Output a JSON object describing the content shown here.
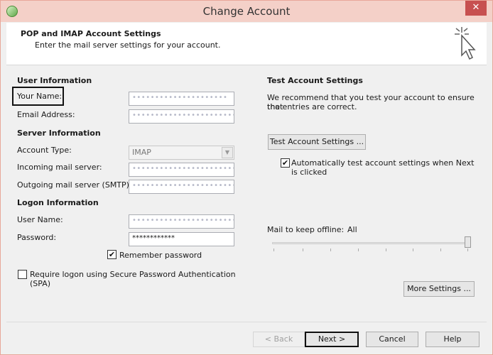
{
  "window": {
    "title": "Change Account"
  },
  "header": {
    "title": "POP and IMAP Account Settings",
    "subtitle": "Enter the mail server settings for your account."
  },
  "user_info": {
    "section": "User Information",
    "name_label": "Your Name:",
    "name_value": "•••••••••••••••••••••",
    "email_label": "Email Address:",
    "email_value": "••••••••••••••••••••••••"
  },
  "server_info": {
    "section": "Server Information",
    "account_type_label": "Account Type:",
    "account_type_value": "IMAP",
    "incoming_label": "Incoming mail server:",
    "incoming_value": "••••••••••••••••••••••••",
    "outgoing_label": "Outgoing mail server (SMTP):",
    "outgoing_value": "••••••••••••••••••••••••"
  },
  "logon_info": {
    "section": "Logon Information",
    "username_label": "User Name:",
    "username_value": "••••••••••••••••••••••••",
    "password_label": "Password:",
    "password_value": "************",
    "remember_label": "Remember password",
    "remember_checked": true,
    "spa_label_1": "Require logon using Secure Password Authentication",
    "spa_label_2": "(SPA)",
    "spa_checked": false
  },
  "test_settings": {
    "section": "Test Account Settings",
    "description_1": "We recommend that you test your account to ensure that",
    "description_2": "the entries are correct.",
    "test_button": "Test Account Settings ...",
    "auto_test_label_1": "Automatically test account settings when Next",
    "auto_test_label_2": "is clicked",
    "auto_test_checked": true
  },
  "offline": {
    "label": "Mail to keep offline:",
    "value": "All",
    "slider_level": 1.0
  },
  "more_settings_button": "More Settings ...",
  "footer": {
    "back": "< Back",
    "next": "Next >",
    "cancel": "Cancel",
    "help": "Help"
  },
  "colors": {
    "titlebar": "#f4d0c8",
    "close": "#c75050"
  },
  "icons": {
    "app": "outlook-icon",
    "close": "close-icon",
    "header": "cursor-click-icon",
    "check": "check-icon",
    "dropdown": "chevron-down-icon"
  }
}
